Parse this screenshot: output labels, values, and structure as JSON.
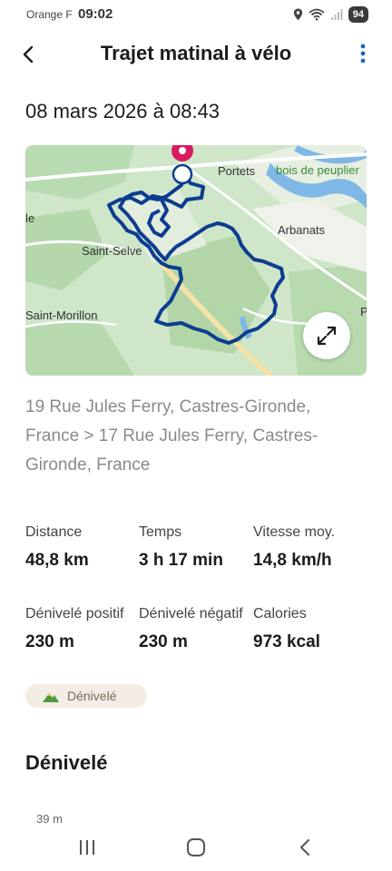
{
  "status_bar": {
    "carrier": "Orange F",
    "time": "09:02",
    "battery": "94",
    "icons": [
      "location-icon",
      "wifi-icon",
      "signal-icon"
    ]
  },
  "header": {
    "title": "Trajet matinal à vélo",
    "back_icon": "back-arrow-icon",
    "more_icon": "more-vert-icon"
  },
  "activity": {
    "date": "08 mars 2026 à 08:43",
    "address": "19 Rue Jules Ferry, Castres-Gironde, France > 17 Rue Jules Ferry, Castres-Gironde, France"
  },
  "map": {
    "labels": {
      "portets": "Portets",
      "bois": "bois de peuplier",
      "le": "le",
      "arbanats": "Arbanats",
      "saint_selve": "Saint-Selve",
      "saint_morillon": "Saint-Morillon",
      "p": "P"
    },
    "route_color": "#0d3d91",
    "pin_color": "#d81b60",
    "expand_icon": "expand-icon"
  },
  "stats": [
    {
      "label": "Distance",
      "value": "48,8 km"
    },
    {
      "label": "Temps",
      "value": "3 h 17 min"
    },
    {
      "label": "Vitesse moy.",
      "value": "14,8 km/h"
    },
    {
      "label": "Dénivelé positif",
      "value": "230 m"
    },
    {
      "label": "Dénivelé négatif",
      "value": "230 m"
    },
    {
      "label": "Calories",
      "value": "973 kcal"
    }
  ],
  "chip": {
    "label": "Dénivelé",
    "icon": "mountain-icon"
  },
  "elevation": {
    "title": "Dénivelé",
    "top_tick": "39 m"
  },
  "nav_bar": {
    "icons": [
      "recent-apps-icon",
      "home-icon",
      "back-icon"
    ]
  }
}
